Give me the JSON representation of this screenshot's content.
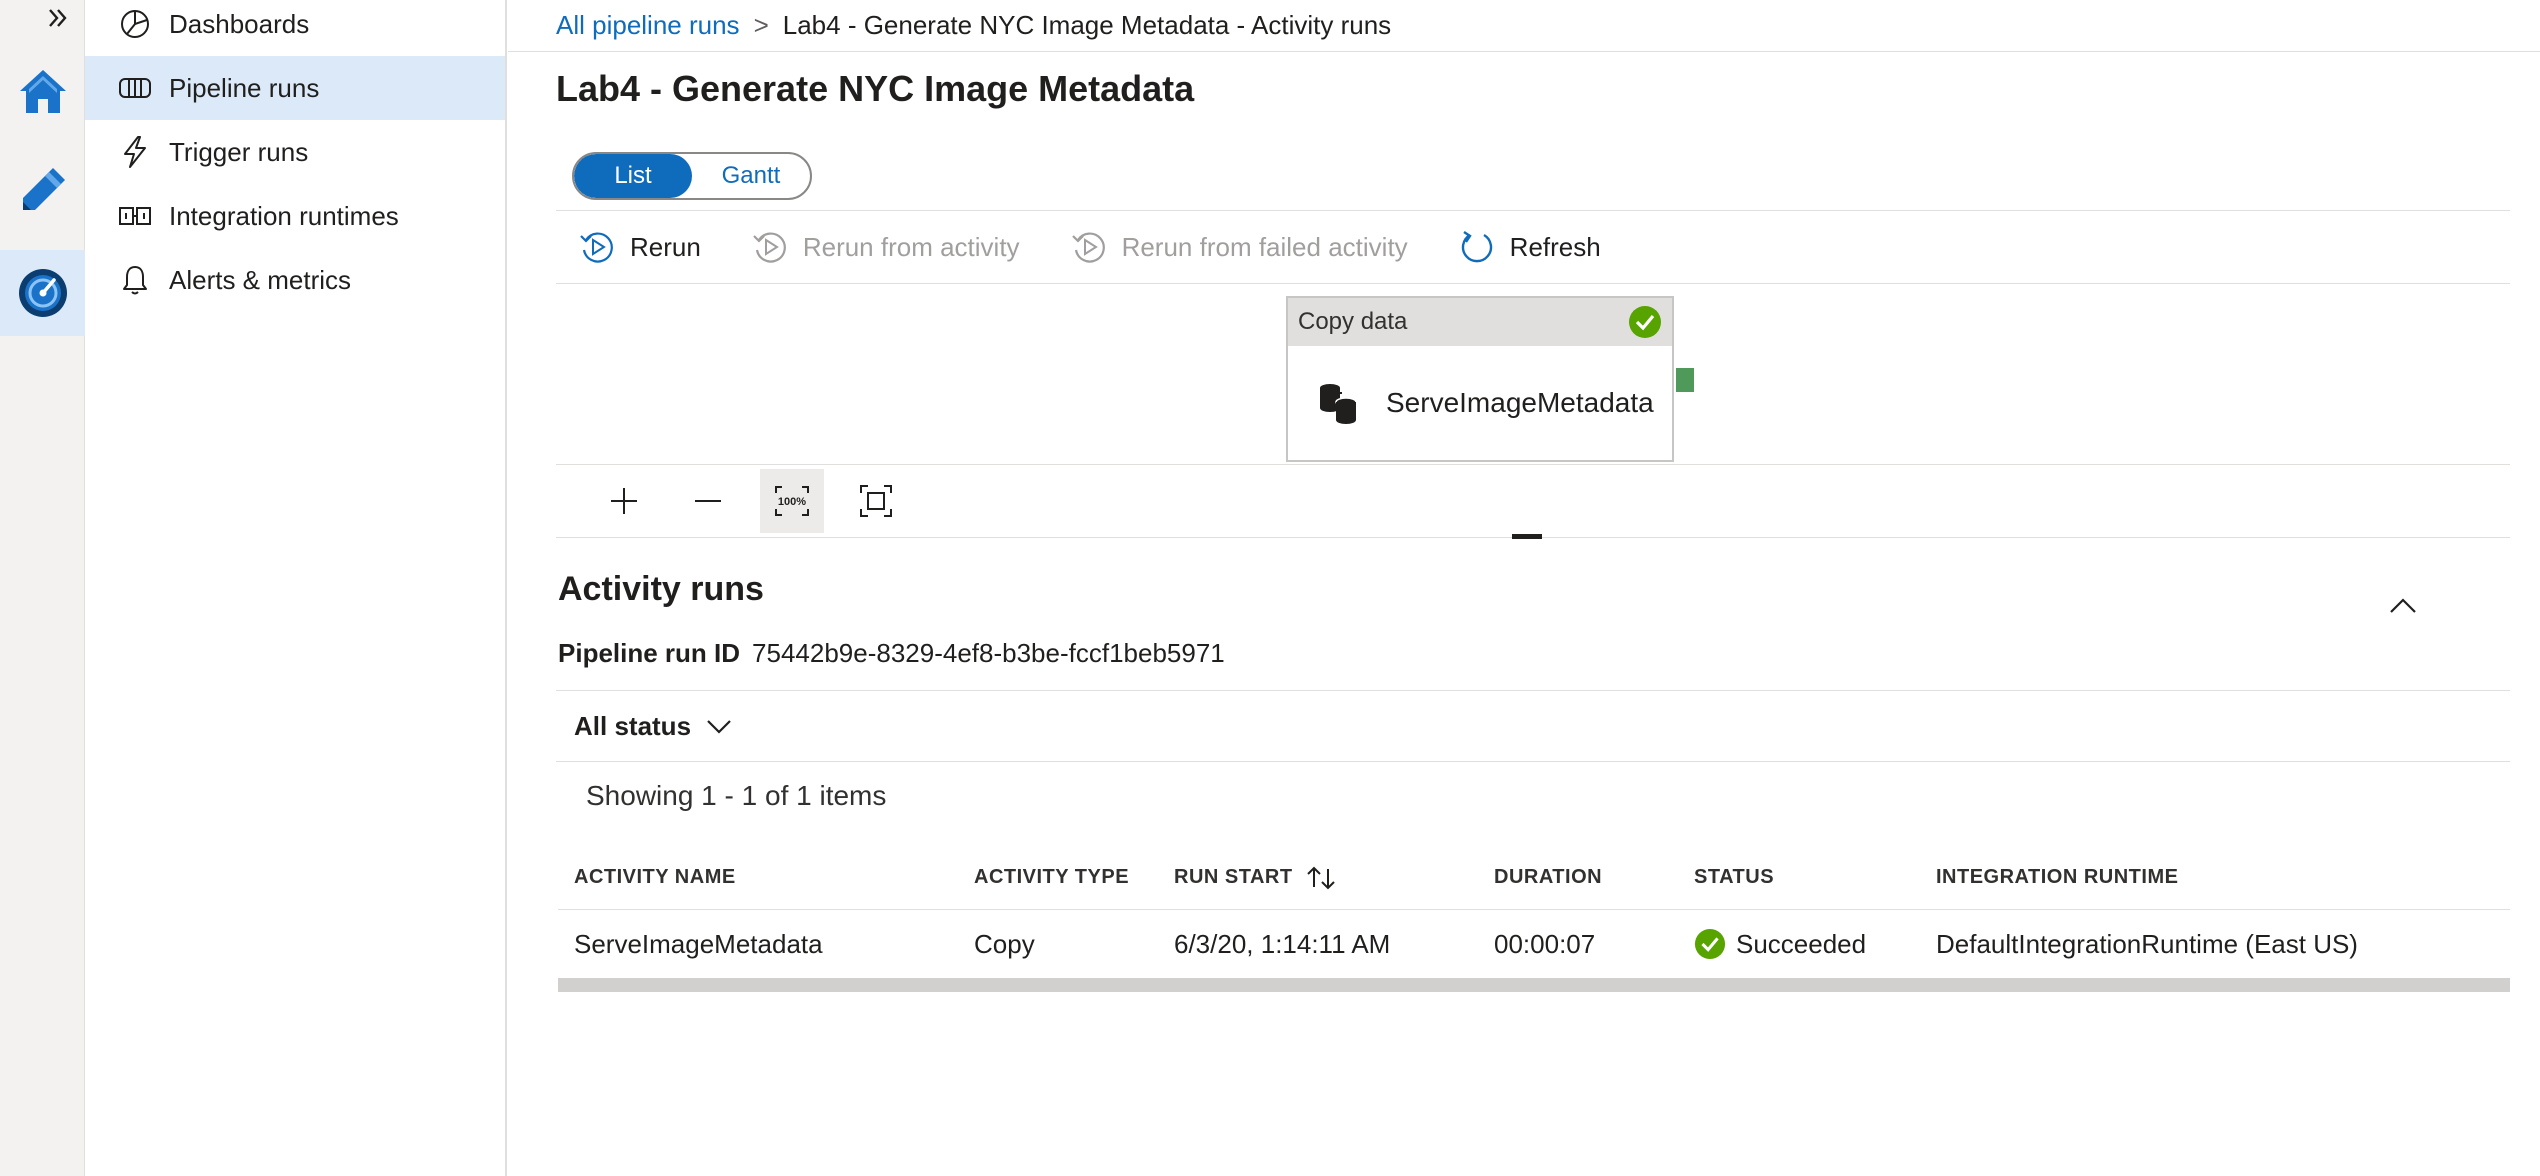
{
  "colors": {
    "accent": "#0f6cbd",
    "success": "#57a300",
    "nav_active": "#dbe9f8",
    "disabled": "#a19f9d"
  },
  "rail": {
    "expand_icon": "double-chevron-right-icon",
    "items": [
      {
        "icon": "home-icon"
      },
      {
        "icon": "pencil-icon"
      },
      {
        "icon": "monitor-gauge-icon"
      }
    ]
  },
  "nav": {
    "items": [
      {
        "label": "Dashboards",
        "icon": "dashboard-icon"
      },
      {
        "label": "Pipeline runs",
        "icon": "pipeline-icon"
      },
      {
        "label": "Trigger runs",
        "icon": "lightning-icon"
      },
      {
        "label": "Integration runtimes",
        "icon": "integration-runtime-icon"
      },
      {
        "label": "Alerts & metrics",
        "icon": "bell-icon"
      }
    ]
  },
  "breadcrumb": {
    "link": "All pipeline runs",
    "separator": ">",
    "current": "Lab4 - Generate NYC Image Metadata - Activity runs"
  },
  "page": {
    "title": "Lab4 - Generate NYC Image Metadata"
  },
  "view_toggle": {
    "options": [
      "List",
      "Gantt"
    ],
    "selected": "List"
  },
  "toolbar": {
    "rerun": "Rerun",
    "rerun_from_activity": "Rerun from activity",
    "rerun_from_failed": "Rerun from failed activity",
    "refresh": "Refresh"
  },
  "activity_node": {
    "type": "Copy data",
    "name": "ServeImageMetadata",
    "status_icon": "success-check-icon"
  },
  "zoom_controls": [
    "zoom-in-icon",
    "zoom-out-icon",
    "zoom-100-icon",
    "fit-to-screen-icon"
  ],
  "activity_runs": {
    "title": "Activity runs",
    "run_id_label": "Pipeline run ID",
    "run_id": "75442b9e-8329-4ef8-b3be-fccf1beb5971",
    "status_filter": "All status",
    "showing": "Showing 1 - 1 of 1 items",
    "columns": [
      "ACTIVITY NAME",
      "ACTIVITY TYPE",
      "RUN START",
      "DURATION",
      "STATUS",
      "INTEGRATION RUNTIME"
    ],
    "rows": [
      {
        "activity_name": "ServeImageMetadata",
        "activity_type": "Copy",
        "run_start": "6/3/20, 1:14:11 AM",
        "duration": "00:00:07",
        "status": "Succeeded",
        "integration_runtime": "DefaultIntegrationRuntime (East US)"
      }
    ]
  }
}
